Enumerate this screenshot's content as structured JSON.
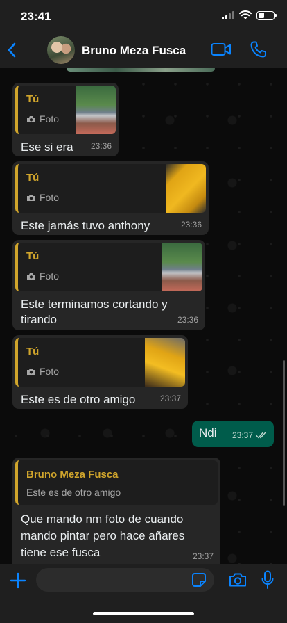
{
  "status_bar": {
    "time": "23:41"
  },
  "header": {
    "contact_name": "Bruno Meza Fusca"
  },
  "messages": [
    {
      "quote_author": "Tú",
      "quote_type": "Foto",
      "text": "Ese si era",
      "time": "23:36"
    },
    {
      "quote_author": "Tú",
      "quote_type": "Foto",
      "text": "Este jamás tuvo anthony",
      "time": "23:36"
    },
    {
      "quote_author": "Tú",
      "quote_type": "Foto",
      "text": "Este terminamos cortando y tirando",
      "time": "23:36"
    },
    {
      "quote_author": "Tú",
      "quote_type": "Foto",
      "text": "Este es de otro amigo",
      "time": "23:37"
    },
    {
      "text": "Ndi",
      "time": "23:37"
    },
    {
      "quote_author": "Bruno Meza Fusca",
      "quote_text": "Este es de otro amigo",
      "text": "Que mando nm foto de cuando mando pintar pero hace añares tiene ese fusca",
      "time": "23:37"
    }
  ],
  "input": {
    "value": "",
    "placeholder": ""
  },
  "colors": {
    "accent": "#0a84ff",
    "quote_author": "#d0a52c",
    "outgoing_bubble": "#005c4b",
    "incoming_bubble": "#262626"
  },
  "icons": [
    "back-icon",
    "video-call-icon",
    "phone-icon",
    "camera-icon",
    "double-check-icon",
    "plus-icon",
    "sticker-icon",
    "mic-icon"
  ]
}
